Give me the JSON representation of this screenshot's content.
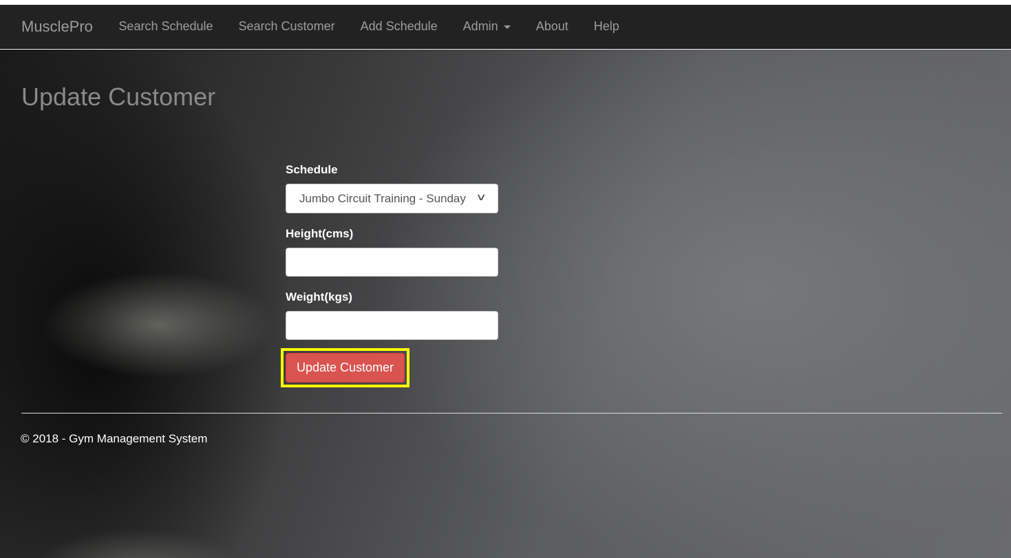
{
  "navbar": {
    "brand": "MusclePro",
    "items": [
      {
        "label": "Search Schedule"
      },
      {
        "label": "Search Customer"
      },
      {
        "label": "Add Schedule"
      },
      {
        "label": "Admin"
      },
      {
        "label": "About"
      },
      {
        "label": "Help"
      }
    ]
  },
  "page": {
    "title": "Update Customer"
  },
  "form": {
    "schedule_label": "Schedule",
    "schedule_value": "Jumbo Circuit Training - Sunday",
    "height_label": "Height(cms)",
    "height_value": "",
    "weight_label": "Weight(kgs)",
    "weight_value": "",
    "submit_label": "Update Customer"
  },
  "footer": {
    "text": "© 2018 - Gym Management System"
  },
  "colors": {
    "navbar_bg": "#222222",
    "button_danger": "#d9534f",
    "highlight": "#ffff00"
  }
}
